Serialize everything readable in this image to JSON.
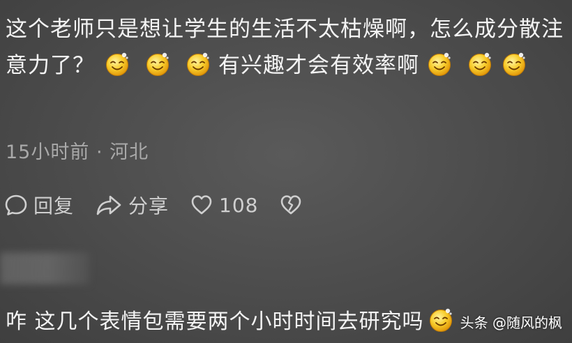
{
  "comment": {
    "text_part1": "这个老师只是想让学生的生活不太枯燥啊，怎么成分散注意力了？",
    "text_part2": "有兴趣才会有效率啊",
    "emoji_name": "smiling-face-emoji"
  },
  "meta": {
    "time": "15小时前",
    "separator": "·",
    "location": "河北"
  },
  "actions": {
    "reply_label": "回复",
    "share_label": "分享",
    "like_count": "108"
  },
  "reply": {
    "text": "咋 这几个表情包需要两个小时时间去研究吗"
  },
  "watermark": "头条 @随风的枫",
  "colors": {
    "background": "#4e4e4e",
    "text": "#f4f4f4",
    "meta_text": "#a9a9a9",
    "emoji_face": "#f5c518"
  }
}
